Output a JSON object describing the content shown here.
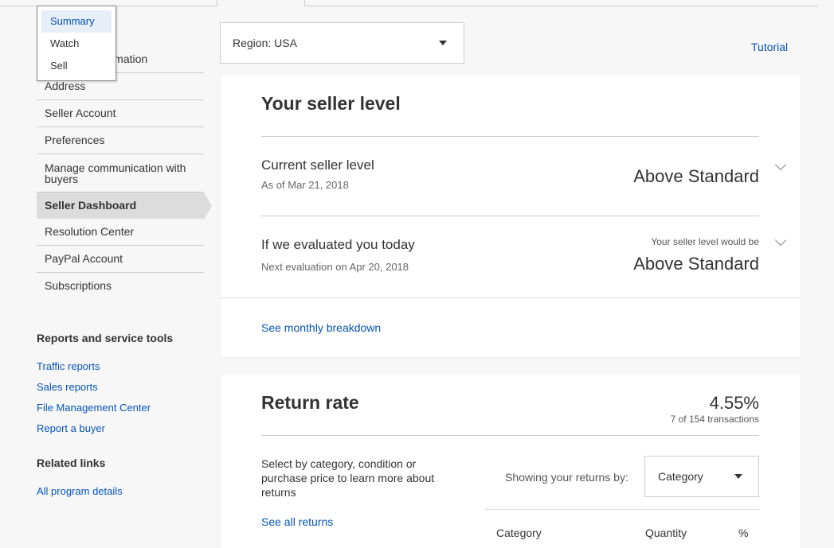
{
  "sidebar": {
    "items": [
      {
        "label": "Personal Information"
      },
      {
        "label": "Address"
      },
      {
        "label": "Seller Account"
      },
      {
        "label": "Preferences"
      },
      {
        "label": "Manage communication with buyers"
      },
      {
        "label": "Seller Dashboard"
      },
      {
        "label": "Resolution Center"
      },
      {
        "label": "PayPal Account"
      },
      {
        "label": "Subscriptions"
      }
    ],
    "reports_heading": "Reports and service tools",
    "reports_links": [
      "Traffic reports",
      "Sales reports",
      "File Management Center",
      "Report a buyer"
    ],
    "related_heading": "Related links",
    "related_links": [
      "All program details"
    ]
  },
  "popup": {
    "items": [
      "Summary",
      "Watch",
      "Sell"
    ],
    "selected": "Summary"
  },
  "region": {
    "label": "Region: USA"
  },
  "tutorial": "Tutorial",
  "seller_level": {
    "title": "Your seller level",
    "current_title": "Current seller level",
    "current_date": "As of Mar 21, 2018",
    "current_level": "Above Standard",
    "eval_title": "If we evaluated you today",
    "eval_date": "Next evaluation on Apr 20, 2018",
    "eval_hint": "Your seller level would be",
    "eval_level": "Above Standard",
    "breakdown_link": "See monthly breakdown"
  },
  "return_rate": {
    "title": "Return rate",
    "rate": "4.55%",
    "transactions": "7 of 154 transactions",
    "description": "Select by category, condition or purchase price to learn more about returns",
    "see_all": "See all returns",
    "showing_label": "Showing your returns by:",
    "select_value": "Category",
    "columns": [
      "Category",
      "Quantity",
      "%"
    ]
  },
  "colors": {
    "link": "#0654ba",
    "active_nav": "#dcdcdc"
  }
}
